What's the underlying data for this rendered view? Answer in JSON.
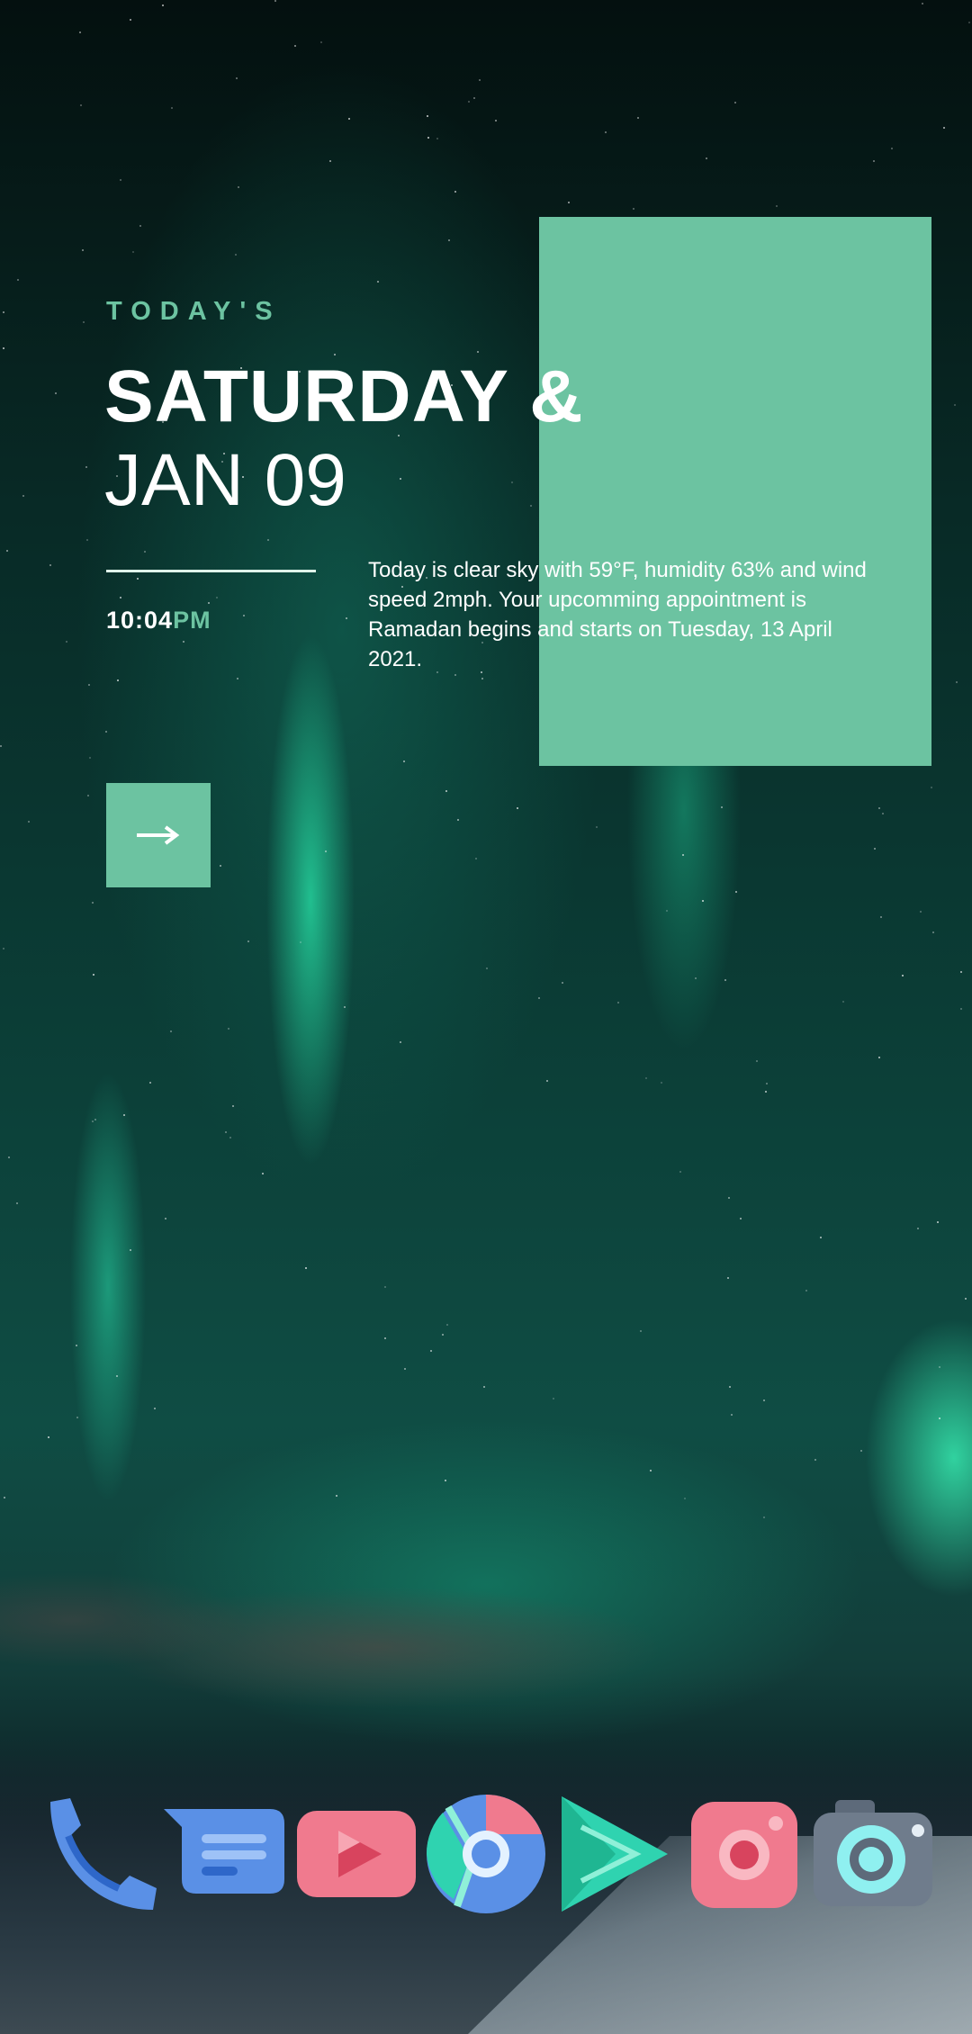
{
  "widget": {
    "label": "TODAY'S",
    "day": "SATURDAY &",
    "date": "JAN 09",
    "time": "10:04",
    "ampm": "PM",
    "description": "Today is clear sky with 59°F, humidity 63% and wind speed 2mph. Your upcomming appointment is Ramadan begins and starts on Tuesday, 13 April 2021.",
    "arrow_icon": "arrow-right-icon"
  },
  "colors": {
    "accent": "#6cc3a1",
    "text": "#ffffff"
  },
  "dock": [
    {
      "app": "phone",
      "icon": "phone-icon"
    },
    {
      "app": "messages",
      "icon": "messages-icon"
    },
    {
      "app": "youtube",
      "icon": "youtube-icon"
    },
    {
      "app": "chrome",
      "icon": "chrome-icon"
    },
    {
      "app": "play-store",
      "icon": "play-store-icon"
    },
    {
      "app": "instagram",
      "icon": "instagram-icon"
    },
    {
      "app": "camera",
      "icon": "camera-icon"
    }
  ]
}
